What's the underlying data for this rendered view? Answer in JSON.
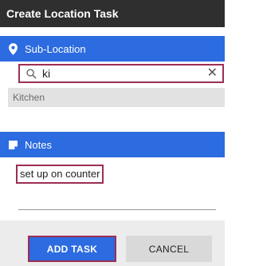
{
  "dialog": {
    "title": "Create Location Task"
  },
  "sub_location": {
    "header_label": "Sub-Location",
    "header_icon": "location-pin-icon",
    "search": {
      "value": "ki",
      "icon": "search-icon",
      "clear_icon": "close-icon"
    },
    "suggestions": [
      "Kitchen"
    ]
  },
  "notes": {
    "header_label": "Notes",
    "header_icon": "note-icon",
    "value": "set up on counter"
  },
  "actions": {
    "add_label": "ADD TASK",
    "cancel_label": "CANCEL"
  },
  "colors": {
    "title_bar": "#2f2f2f",
    "section_header": "#2c6be0",
    "highlight_border": "#9b2f52",
    "footer": "#ececec"
  }
}
